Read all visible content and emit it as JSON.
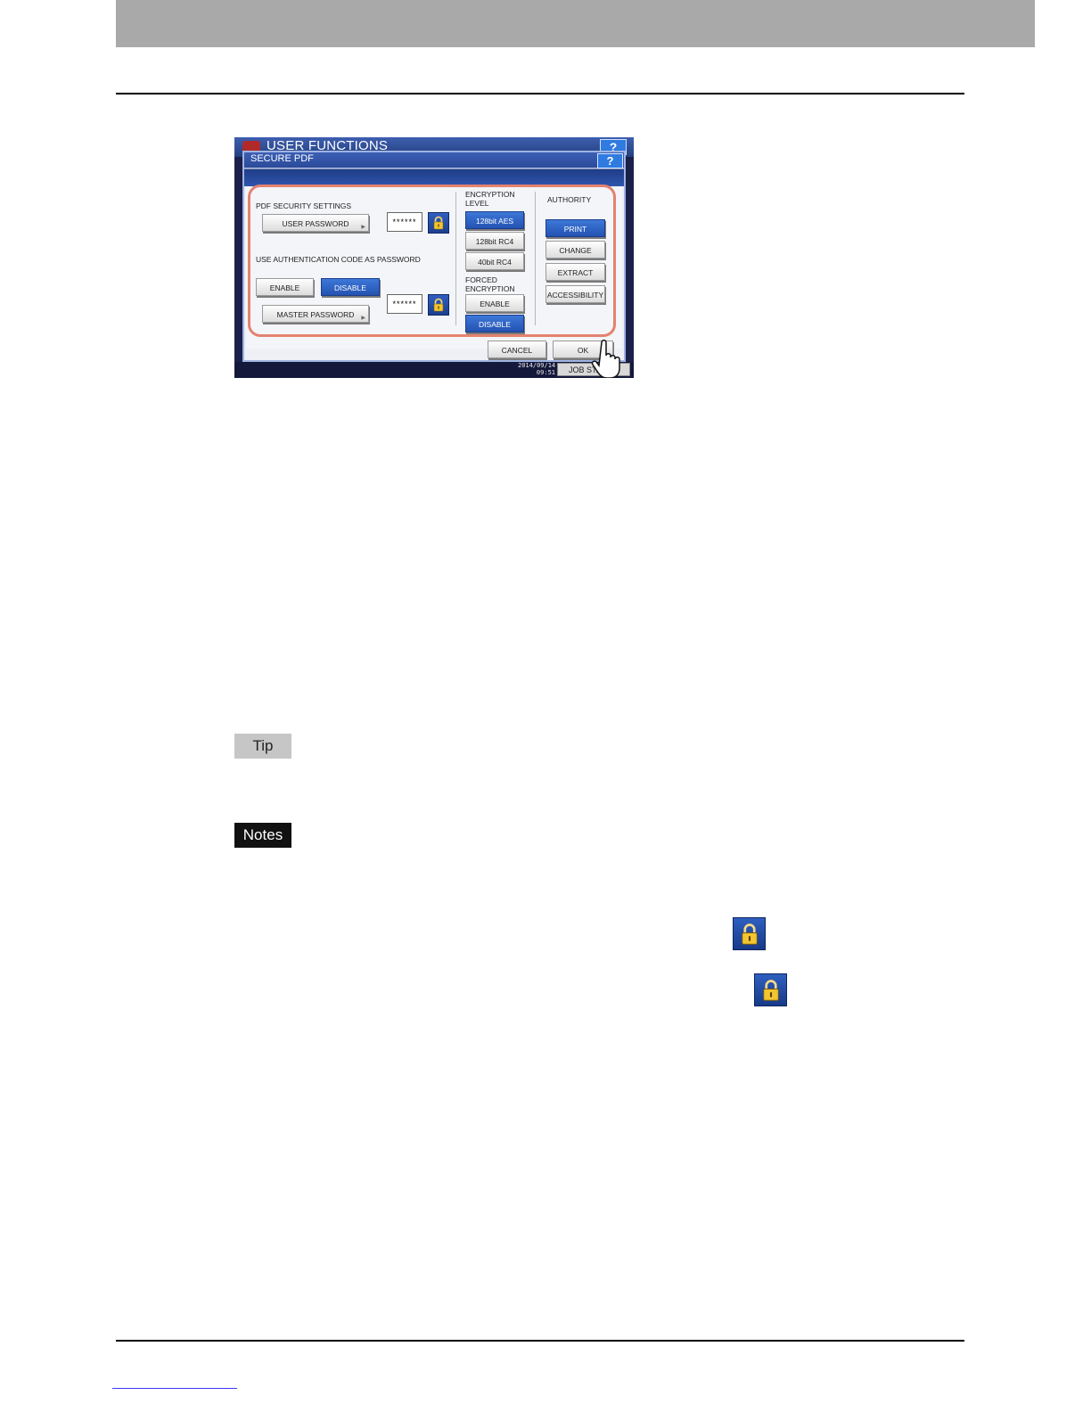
{
  "screenshot": {
    "app_title": "USER FUNCTIONS",
    "app_help": "?",
    "dialog": {
      "title": "SECURE PDF",
      "help": "?",
      "pdf_security_settings_label": "PDF SECURITY SETTINGS",
      "user_password_button": "USER PASSWORD",
      "user_password_value": "******",
      "use_auth_code_label": "USE AUTHENTICATION CODE AS PASSWORD",
      "auth_enable_button": "ENABLE",
      "auth_disable_button": "DISABLE",
      "master_password_button": "MASTER PASSWORD",
      "master_password_value": "******",
      "encryption_level_label_line1": "ENCRYPTION",
      "encryption_level_label_line2": "LEVEL",
      "encryption_options": [
        "128bit AES",
        "128bit RC4",
        "40bit RC4"
      ],
      "forced_encryption_label_line1": "FORCED",
      "forced_encryption_label_line2": "ENCRYPTION",
      "forced_enable_button": "ENABLE",
      "forced_disable_button": "DISABLE",
      "authority_label": "AUTHORITY",
      "authority_options": [
        "PRINT",
        "CHANGE",
        "EXTRACT",
        "ACCESSIBILITY"
      ],
      "cancel_button": "CANCEL",
      "ok_button": "OK"
    },
    "datetime_line1": "2014/09/14",
    "datetime_line2": "09:51",
    "job_status_button": "JOB STATUS"
  },
  "tip_label": "Tip",
  "notes_label": "Notes",
  "colors": {
    "header_bar": "#a9a9a9",
    "selected_button": "#2452b2",
    "highlight_outline": "#e4826f"
  },
  "icons": [
    "lock-icon",
    "pointer-hand-icon"
  ]
}
